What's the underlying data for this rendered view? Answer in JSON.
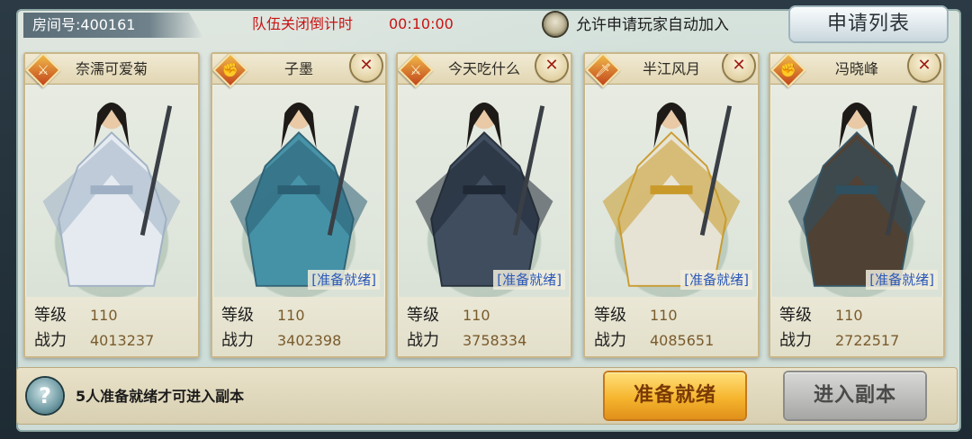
{
  "room": {
    "label": "房间号:400161"
  },
  "countdown": {
    "label": "队伍关闭倒计时",
    "value": "00:10:00"
  },
  "auto_join": {
    "label": "允许申请玩家自动加入"
  },
  "apply_list": {
    "label": "申请列表"
  },
  "stat_labels": {
    "level": "等级",
    "power": "战力"
  },
  "players": [
    {
      "name": "奈濡可爱菊",
      "class_icon": "sword-icon",
      "class_glyph": "⚔",
      "kickable": false,
      "ready_tag": "",
      "level": "110",
      "power": "4013237",
      "robe_color": "#e7ecf3",
      "accent_color": "#9fb0c4"
    },
    {
      "name": "子墨",
      "class_icon": "fist-icon",
      "class_glyph": "✊",
      "kickable": true,
      "ready_tag": "[准备就绪]",
      "level": "110",
      "power": "3402398",
      "robe_color": "#3f8fa6",
      "accent_color": "#2b5f73"
    },
    {
      "name": "今天吃什么",
      "class_icon": "sword-icon",
      "class_glyph": "⚔",
      "kickable": true,
      "ready_tag": "[准备就绪]",
      "level": "110",
      "power": "3758334",
      "robe_color": "#39475a",
      "accent_color": "#1f2835"
    },
    {
      "name": "半江风月",
      "class_icon": "blade-icon",
      "class_glyph": "🗡",
      "kickable": true,
      "ready_tag": "[准备就绪]",
      "level": "110",
      "power": "4085651",
      "robe_color": "#e9e4d6",
      "accent_color": "#c99a2a"
    },
    {
      "name": "冯晓峰",
      "class_icon": "fist-icon",
      "class_glyph": "✊",
      "kickable": true,
      "ready_tag": "[准备就绪]",
      "level": "110",
      "power": "2722517",
      "robe_color": "#4a3a2c",
      "accent_color": "#2f5060"
    }
  ],
  "footer": {
    "hint": "5人准备就绪才可进入副本",
    "ready_button": "准备就绪",
    "enter_button": "进入副本"
  }
}
